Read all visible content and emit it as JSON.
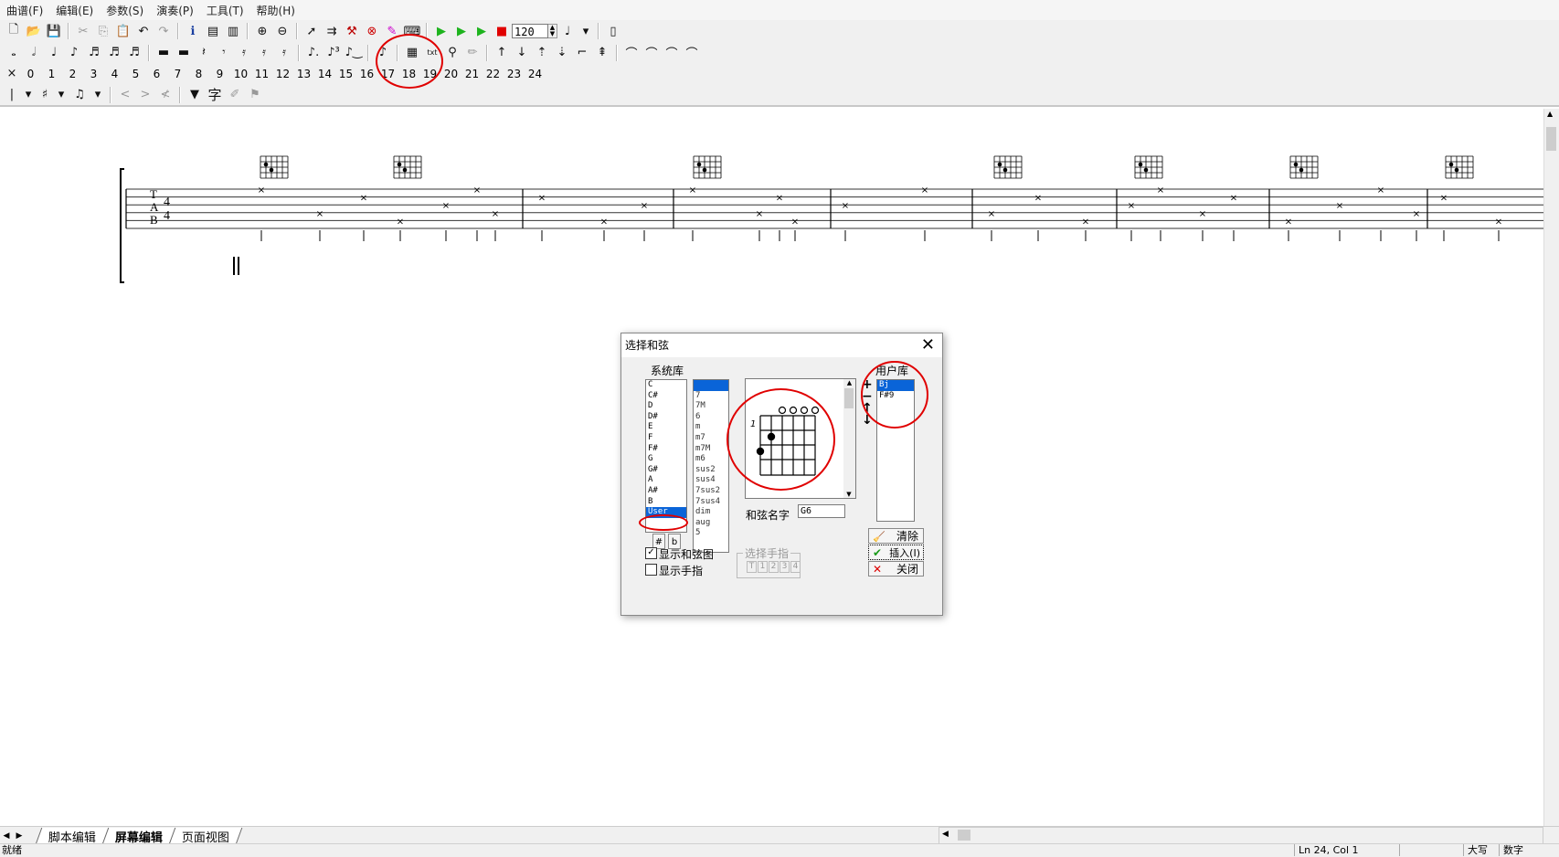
{
  "menu": [
    "曲谱(F)",
    "编辑(E)",
    "参数(S)",
    "演奏(P)",
    "工具(T)",
    "帮助(H)"
  ],
  "toolbar": {
    "tempo": "120"
  },
  "fret_numbers": [
    "0",
    "1",
    "2",
    "3",
    "4",
    "5",
    "6",
    "7",
    "8",
    "9",
    "10",
    "11",
    "12",
    "13",
    "14",
    "15",
    "16",
    "17",
    "18",
    "19",
    "20",
    "21",
    "22",
    "23",
    "24"
  ],
  "toolbar4": {
    "char_label": "字"
  },
  "score": {
    "time_top": "4",
    "time_bottom": "4",
    "tab_letters": [
      "T",
      "A",
      "B"
    ]
  },
  "bottom_tabs": [
    "脚本编辑",
    "屏幕编辑",
    "页面视图"
  ],
  "status": {
    "left": "就绪",
    "position": "Ln 24, Col 1",
    "caps": "大写",
    "num": "数字"
  },
  "dialog": {
    "title": "选择和弦",
    "system_lib_label": "系统库",
    "roots": [
      "C",
      "C#",
      "D",
      "D#",
      "E",
      "F",
      "F#",
      "G",
      "G#",
      "A",
      "A#",
      "B",
      "User"
    ],
    "root_selected_index": 12,
    "qualities": [
      "",
      "7",
      "7M",
      "6",
      "m",
      "m7",
      "m7M",
      "m6",
      "sus2",
      "sus4",
      "7sus2",
      "7sus4",
      "dim",
      "aug",
      "5"
    ],
    "quality_selected_index": 0,
    "sharp_btn": "#",
    "flat_btn": "b",
    "fret_marker": "1",
    "chord_name_label": "和弦名字",
    "chord_name_value": "G6",
    "user_lib_label": "用户库",
    "user_items": [
      "Bj",
      "F#9"
    ],
    "user_selected_index": 0,
    "clear_btn": "清除",
    "insert_btn": "插入(I)",
    "close_btn": "关闭",
    "show_chord_label": "显示和弦图",
    "show_chord_checked": true,
    "show_finger_label": "显示手指",
    "show_finger_checked": false,
    "finger_group_label": "选择手指",
    "finger_buttons": [
      "T",
      "1",
      "2",
      "3",
      "4"
    ]
  }
}
